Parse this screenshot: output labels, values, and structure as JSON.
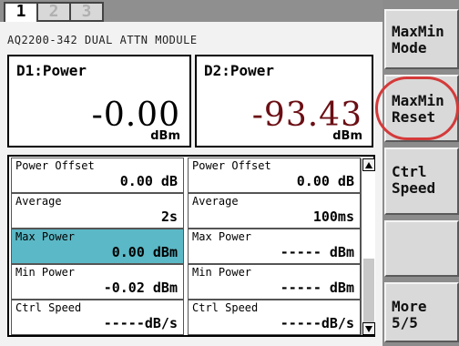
{
  "tabs": [
    {
      "label": "1"
    },
    {
      "label": "2"
    },
    {
      "label": "3"
    }
  ],
  "module_title": "AQ2200-342 DUAL ATTN MODULE",
  "displays": {
    "d1": {
      "label": "D1:Power",
      "value": "-0.00",
      "unit": "dBm"
    },
    "d2": {
      "label": "D2:Power",
      "value": "-93.43",
      "unit": "dBm"
    }
  },
  "params": {
    "left": [
      {
        "title": "Power Offset",
        "value": "0.00 dB"
      },
      {
        "title": "Average",
        "value": "2s"
      },
      {
        "title": "Max Power",
        "value": "0.00 dBm"
      },
      {
        "title": "Min Power",
        "value": "-0.02 dBm"
      },
      {
        "title": "Ctrl Speed",
        "value": "-----dB/s"
      }
    ],
    "right": [
      {
        "title": "Power Offset",
        "value": "0.00 dB"
      },
      {
        "title": "Average",
        "value": "100ms"
      },
      {
        "title": "Max Power",
        "value": "----- dBm"
      },
      {
        "title": "Min Power",
        "value": "----- dBm"
      },
      {
        "title": "Ctrl Speed",
        "value": "-----dB/s"
      }
    ]
  },
  "softkeys": [
    {
      "line1": "MaxMin",
      "line2": "Mode"
    },
    {
      "line1": "MaxMin",
      "line2": "Reset"
    },
    {
      "line1": "Ctrl",
      "line2": "Speed"
    },
    {
      "line1": "",
      "line2": ""
    },
    {
      "line1": "More",
      "line2": "5/5"
    }
  ],
  "colors": {
    "selected_cell": "#5bb8c6",
    "d2_value": "#6b0f14",
    "highlight_ring": "#d43a3a"
  }
}
